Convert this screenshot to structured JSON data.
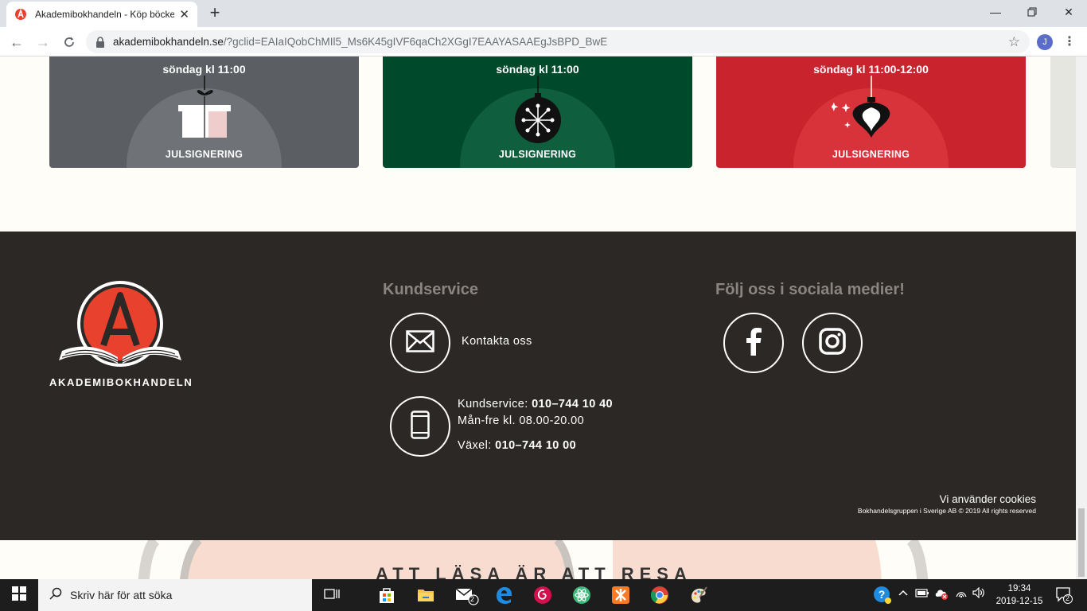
{
  "browser": {
    "tab_title": "Akademibokhandeln - Köp böcker",
    "url_host": "akademibokhandeln.se",
    "url_path": "/?gclid=EAIaIQobChMIl5_Ms6K45gIVF6qaCh2XGgI7EAAYASAAEgJsBPD_BwE",
    "profile_initial": "J"
  },
  "events": [
    {
      "when": "söndag kl 11:00",
      "label": "JULSIGNERING",
      "bg": "#5b5e62",
      "circle": "#6f7277",
      "icon": "gift-icon"
    },
    {
      "when": "söndag kl 11:00",
      "label": "JULSIGNERING",
      "bg": "#00492b",
      "circle": "#0f5f3e",
      "icon": "ornament-star-icon"
    },
    {
      "when": "söndag kl 11:00-12:00",
      "label": "JULSIGNERING",
      "bg": "#c9242d",
      "circle": "#d8323a",
      "icon": "ornament-bauble-icon"
    }
  ],
  "footer": {
    "brand_name": "AKADEMIBOKHANDELN",
    "kundservice_title": "Kundservice",
    "contact_label": "Kontakta oss",
    "kundservice_prefix": "Kundservice: ",
    "kundservice_phone": "010–744 10 40",
    "hours": "Mån-fre kl. 08.00-20.00",
    "vaxel_prefix": "Växel: ",
    "vaxel_phone": "010–744 10 00",
    "social_title": "Följ oss i sociala medier!",
    "cookies": "Vi använder cookies",
    "copyright": "Bokhandelsgruppen i Sverige AB © 2019 All rights reserved"
  },
  "tagline": "ATT LÄSA ÄR ATT RESA",
  "taskbar": {
    "search_placeholder": "Skriv här för att söka",
    "mail_badge": "2",
    "time": "19:34",
    "date": "2019-12-15",
    "notifications": "2"
  },
  "colors": {
    "footer_bg": "#2b2825",
    "brand_red": "#e8412e"
  }
}
